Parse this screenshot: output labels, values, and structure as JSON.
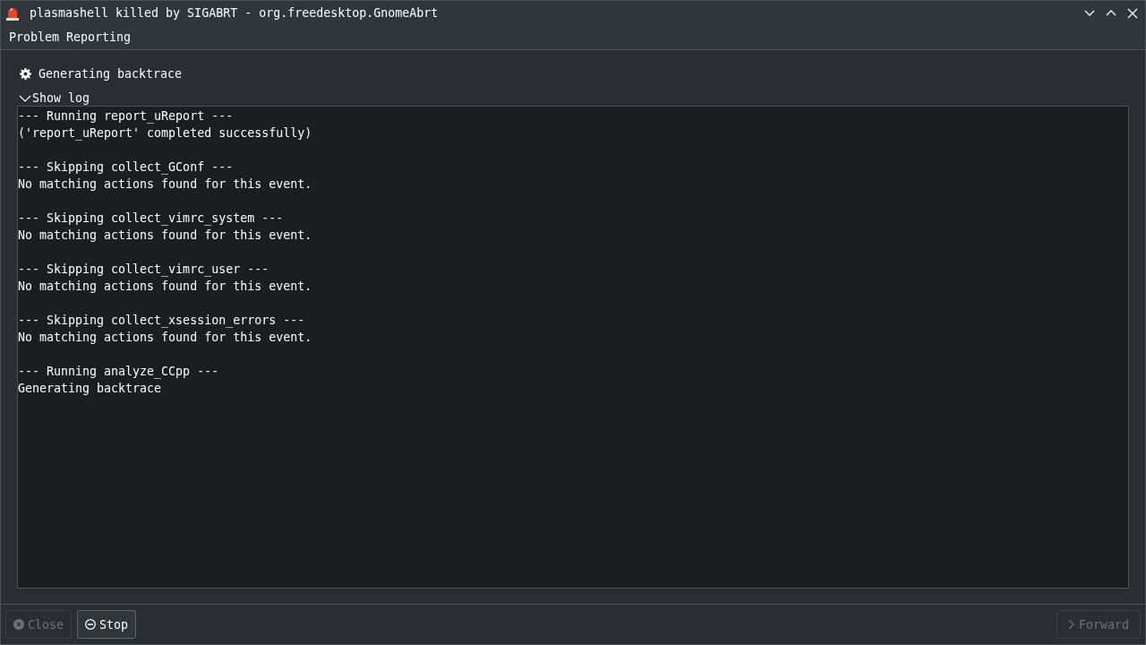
{
  "window": {
    "title": "plasmashell killed by SIGABRT - org.freedesktop.GnomeAbrt"
  },
  "header": {
    "title": "Problem Reporting"
  },
  "status": {
    "text": "Generating backtrace"
  },
  "log": {
    "label": "Show log",
    "expanded": true,
    "groups": [
      {
        "lines": [
          "--- Running report_uReport ---",
          "('report_uReport' completed successfully)"
        ]
      },
      {
        "lines": [
          "--- Skipping collect_GConf ---",
          "No matching actions found for this event."
        ]
      },
      {
        "lines": [
          "--- Skipping collect_vimrc_system ---",
          "No matching actions found for this event."
        ]
      },
      {
        "lines": [
          "--- Skipping collect_vimrc_user ---",
          "No matching actions found for this event."
        ]
      },
      {
        "lines": [
          "--- Skipping collect_xsession_errors ---",
          "No matching actions found for this event."
        ]
      },
      {
        "lines": [
          "--- Running analyze_CCpp ---",
          "Generating backtrace"
        ]
      }
    ]
  },
  "buttons": [
    {
      "kind": "close",
      "label": "Close",
      "disabled": true
    },
    {
      "kind": "stop",
      "label": "Stop",
      "disabled": false
    },
    {
      "kind": "forward",
      "label": "Forward",
      "disabled": true
    }
  ]
}
